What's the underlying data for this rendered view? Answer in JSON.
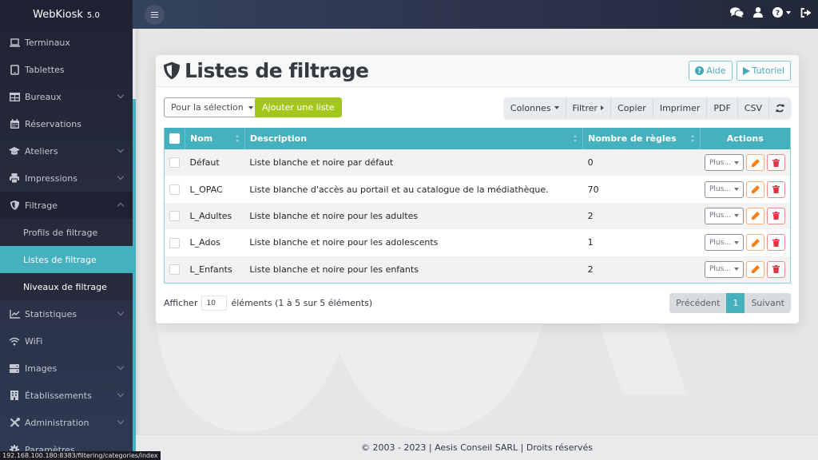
{
  "app": {
    "name": "WebKiosk",
    "version": "5.0"
  },
  "sidebar": {
    "items": [
      {
        "label": "Terminaux",
        "icon": "laptop-icon",
        "has_children": false
      },
      {
        "label": "Tablettes",
        "icon": "tablet-icon",
        "has_children": false
      },
      {
        "label": "Bureaux",
        "icon": "table-icon",
        "has_children": true
      },
      {
        "label": "Réservations",
        "icon": "calendar-icon",
        "has_children": false
      },
      {
        "label": "Ateliers",
        "icon": "graduation-cap-icon",
        "has_children": true
      },
      {
        "label": "Impressions",
        "icon": "printer-icon",
        "has_children": true
      },
      {
        "label": "Filtrage",
        "icon": "shield-icon",
        "has_children": true,
        "expanded": true
      },
      {
        "label": "Statistiques",
        "icon": "chart-line-icon",
        "has_children": true
      },
      {
        "label": "WiFi",
        "icon": "wifi-icon",
        "has_children": false
      },
      {
        "label": "Images",
        "icon": "server-icon",
        "has_children": true
      },
      {
        "label": "Établissements",
        "icon": "building-icon",
        "has_children": true
      },
      {
        "label": "Administration",
        "icon": "tools-icon",
        "has_children": true
      },
      {
        "label": "Paramètres",
        "icon": "gear-icon",
        "has_children": false
      }
    ],
    "filtrage_sub": [
      {
        "label": "Profils de filtrage",
        "active": false
      },
      {
        "label": "Listes de filtrage",
        "active": true
      },
      {
        "label": "Niveaux de filtrage",
        "active": false
      }
    ]
  },
  "status_url": "192.168.100.180:8383/filtering/categories/index",
  "topbar": {
    "icons": [
      "comments-icon",
      "user-icon",
      "help-icon",
      "logout-icon"
    ]
  },
  "page": {
    "title": "Listes de filtrage",
    "help_label": "Aide",
    "tutorial_label": "Tutoriel"
  },
  "toolbar": {
    "selection_label": "Pour la sélection",
    "add_label": "Ajouter une liste",
    "columns_label": "Colonnes",
    "filter_label": "Filtrer",
    "copy_label": "Copier",
    "print_label": "Imprimer",
    "pdf_label": "PDF",
    "csv_label": "CSV"
  },
  "table": {
    "columns": [
      "Nom",
      "Description",
      "Nombre de règles",
      "Actions"
    ],
    "more_label": "Plus...",
    "rows": [
      {
        "name": "Défaut",
        "description": "Liste blanche et noire par défaut",
        "rules": "0"
      },
      {
        "name": "L_OPAC",
        "description": "Liste blanche d'accès au portail et au catalogue de la médiathèque.",
        "rules": "70"
      },
      {
        "name": "L_Adultes",
        "description": "Liste blanche et noire pour les adultes",
        "rules": "2"
      },
      {
        "name": "L_Ados",
        "description": "Liste blanche et noire pour les adolescents",
        "rules": "1"
      },
      {
        "name": "L_Enfants",
        "description": "Liste blanche et noire pour les enfants",
        "rules": "2"
      }
    ]
  },
  "length": {
    "prefix": "Afficher",
    "value": "10",
    "info": "éléments (1 à 5 sur 5 éléments)"
  },
  "pagination": {
    "prev": "Précédent",
    "current": "1",
    "next": "Suivant"
  },
  "footer": {
    "text": "© 2003 - 2023 | Aesis Conseil SARL | Droits réservés"
  },
  "colors": {
    "accent": "#45b0be",
    "add_button": "#a4c81a",
    "sidebar_dark": "#1f2233",
    "edit": "#fd7e14",
    "delete": "#dc3545"
  }
}
